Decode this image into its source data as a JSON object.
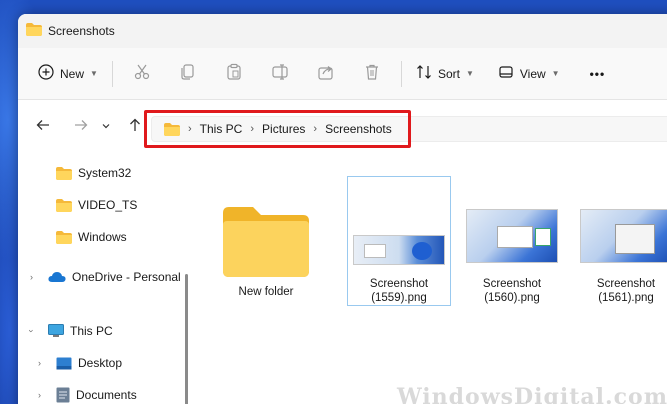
{
  "window": {
    "title": "Screenshots"
  },
  "toolbar": {
    "new_label": "New",
    "sort_label": "Sort",
    "view_label": "View",
    "more_label": "•••"
  },
  "address": {
    "crumbs": [
      "This PC",
      "Pictures",
      "Screenshots"
    ]
  },
  "sidebar": {
    "items": [
      {
        "label": "System32",
        "icon": "folder-icon"
      },
      {
        "label": "VIDEO_TS",
        "icon": "folder-icon"
      },
      {
        "label": "Windows",
        "icon": "folder-icon"
      },
      {
        "label": "OneDrive - Personal",
        "icon": "onedrive-icon"
      },
      {
        "label": "This PC",
        "icon": "monitor-icon"
      },
      {
        "label": "Desktop",
        "icon": "desktop-icon"
      },
      {
        "label": "Documents",
        "icon": "documents-icon"
      }
    ]
  },
  "files": [
    {
      "name": "New folder",
      "type": "folder"
    },
    {
      "name": "Screenshot (1559).png",
      "line1": "Screenshot",
      "line2": "(1559).png",
      "type": "image",
      "selected": true
    },
    {
      "name": "Screenshot (1560).png",
      "line1": "Screenshot",
      "line2": "(1560).png",
      "type": "image"
    },
    {
      "name": "Screenshot (1561).png",
      "line1": "Screenshot",
      "line2": "(1561).png",
      "type": "image"
    }
  ],
  "colors": {
    "highlight_border": "#e0191c",
    "folder_yellow": "#f7c948",
    "selection": "#99c9ef"
  },
  "watermark": "WindowsDigital.com"
}
